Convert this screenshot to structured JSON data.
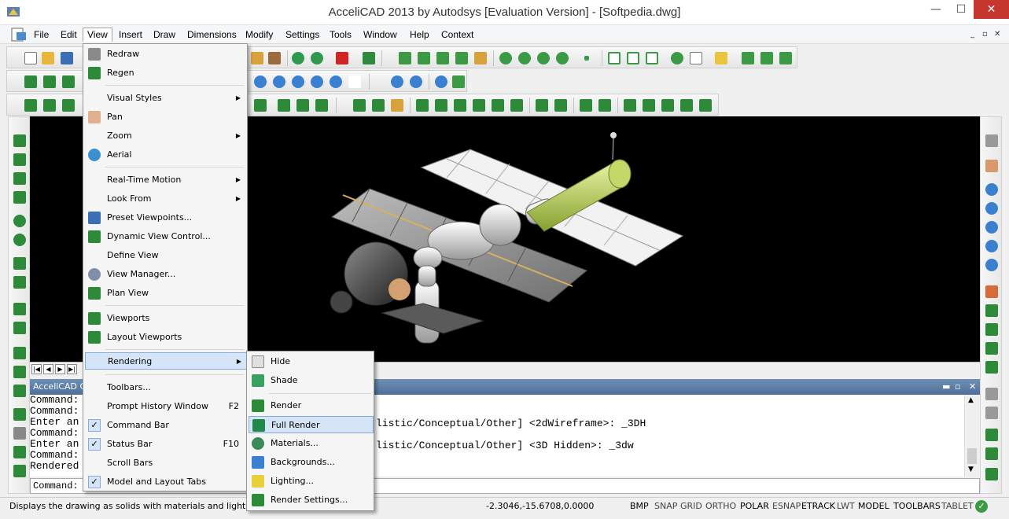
{
  "window": {
    "title": "AcceliCAD 2013 by Autodsys [Evaluation Version] - [Softpedia.dwg]",
    "minimize": "—",
    "maximize": "☐",
    "close": "✕"
  },
  "menubar": {
    "items": [
      "File",
      "Edit",
      "View",
      "Insert",
      "Draw",
      "Dimensions",
      "Modify",
      "Settings",
      "Tools",
      "Window",
      "Help",
      "Context"
    ],
    "active": "View",
    "mdi": [
      "_",
      "▫",
      "✕"
    ]
  },
  "view_menu": [
    {
      "label": "Redraw",
      "icon": "redraw-icon"
    },
    {
      "label": "Regen",
      "icon": "regen-icon"
    },
    {
      "sep": true
    },
    {
      "label": "Visual Styles",
      "submenu": true
    },
    {
      "label": "Pan",
      "icon": "pan-hand-icon"
    },
    {
      "label": "Zoom",
      "submenu": true
    },
    {
      "label": "Aerial",
      "icon": "globe-icon"
    },
    {
      "sep": true
    },
    {
      "label": "Real-Time Motion",
      "submenu": true
    },
    {
      "label": "Look From",
      "submenu": true
    },
    {
      "label": "Preset Viewpoints...",
      "icon": "preset-viewpoints-icon"
    },
    {
      "label": "Dynamic View Control...",
      "icon": "dynamic-view-icon"
    },
    {
      "label": "Define View"
    },
    {
      "label": "View Manager...",
      "icon": "eye-icon"
    },
    {
      "label": "Plan View",
      "icon": "plan-view-icon"
    },
    {
      "sep": true
    },
    {
      "label": "Viewports",
      "icon": "viewports-icon"
    },
    {
      "label": "Layout Viewports",
      "icon": "layout-viewports-icon"
    },
    {
      "sep": true
    },
    {
      "label": "Rendering",
      "submenu": true,
      "highlight": true
    },
    {
      "sep": true
    },
    {
      "label": "Toolbars..."
    },
    {
      "label": "Prompt History Window",
      "accel": "F2"
    },
    {
      "label": "Command Bar",
      "checked": true
    },
    {
      "label": "Status Bar",
      "accel": "F10",
      "checked": true
    },
    {
      "label": "Scroll Bars"
    },
    {
      "label": "Model and Layout Tabs",
      "checked": true
    }
  ],
  "rendering_menu": [
    {
      "label": "Hide",
      "icon": "hide-icon"
    },
    {
      "label": "Shade",
      "icon": "shade-icon"
    },
    {
      "sep": true
    },
    {
      "label": "Render",
      "icon": "render-icon"
    },
    {
      "label": "Full Render",
      "icon": "full-render-icon",
      "highlight": true
    },
    {
      "label": "Materials...",
      "icon": "materials-icon"
    },
    {
      "label": "Backgrounds...",
      "icon": "backgrounds-icon"
    },
    {
      "label": "Lighting...",
      "icon": "lighting-icon"
    },
    {
      "label": "Render Settings...",
      "icon": "render-settings-icon"
    }
  ],
  "command_window": {
    "title": "AcceliCAD C",
    "controls": [
      "▬",
      "▫",
      "✕"
    ],
    "history": [
      "Command:",
      "Command:",
      "Enter an",
      "Command:",
      "Enter an",
      "Command:",
      "Rendered"
    ],
    "history_right": [
      {
        "line": 2,
        "text": "listic/Conceptual/Other] <2dWireframe>: _3DH"
      },
      {
        "line": 4,
        "text": "listic/Conceptual/Other] <3D Hidden>: _3dw"
      }
    ],
    "prompt": "Command:"
  },
  "statusbar": {
    "message": "Displays the drawing as solids with materials and lighting",
    "coords": "-2.3046,-15.6708,0.0000",
    "buttons": [
      {
        "label": "BMP",
        "on": true
      },
      {
        "label": "SNAP",
        "on": false
      },
      {
        "label": "GRID",
        "on": false
      },
      {
        "label": "ORTHO",
        "on": false
      },
      {
        "label": "POLAR",
        "on": true
      },
      {
        "label": "ESNAP",
        "on": false
      },
      {
        "label": "ETRACK",
        "on": true
      },
      {
        "label": "LWT",
        "on": false
      },
      {
        "label": "MODEL",
        "on": true
      },
      {
        "label": "TOOLBARS",
        "on": true
      },
      {
        "label": "TABLET",
        "on": false
      }
    ]
  },
  "colors": {
    "titlebar_close": "#c7372f",
    "menu_highlight": "#d5e5f7",
    "command_title": "#5a7ba5",
    "viewport_bg": "#000000"
  }
}
